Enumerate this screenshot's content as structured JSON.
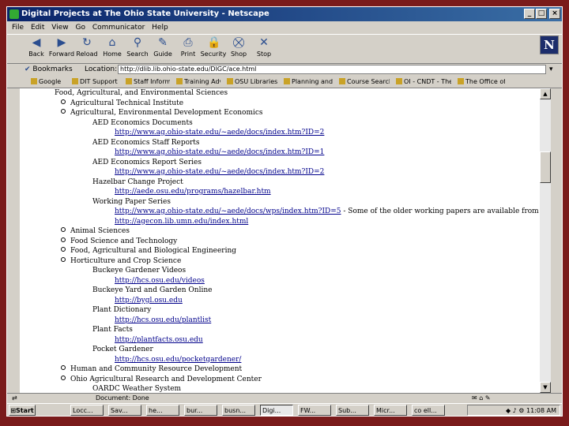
{
  "window": {
    "title": "Digital Projects at The Ohio State University - Netscape"
  },
  "menu": [
    "File",
    "Edit",
    "View",
    "Go",
    "Communicator",
    "Help"
  ],
  "toolbar": [
    {
      "label": "Back",
      "icon": "back-arrow-icon",
      "glyph": "◀"
    },
    {
      "label": "Forward",
      "icon": "forward-arrow-icon",
      "glyph": "▶"
    },
    {
      "label": "Reload",
      "icon": "reload-icon",
      "glyph": "↻"
    },
    {
      "label": "Home",
      "icon": "home-icon",
      "glyph": "⌂"
    },
    {
      "label": "Search",
      "icon": "search-icon",
      "glyph": "⚲"
    },
    {
      "label": "Guide",
      "icon": "guide-icon",
      "glyph": "✎"
    },
    {
      "label": "Print",
      "icon": "print-icon",
      "glyph": "⎙"
    },
    {
      "label": "Security",
      "icon": "lock-icon",
      "glyph": "🔒"
    },
    {
      "label": "Shop",
      "icon": "shop-icon",
      "glyph": "⛒"
    },
    {
      "label": "Stop",
      "icon": "stop-icon",
      "glyph": "✕"
    }
  ],
  "location": {
    "bookmarks_label": "Bookmarks",
    "location_label": "Location:",
    "url": "http://dlib.lib.ohio-state.edu/DIGC/ace.html"
  },
  "bookmarks": [
    "Google",
    "DIT Support Cen",
    "Staff Informati",
    "Training Advisc",
    "OSU Libraries C",
    "Planning and Pc",
    "Course Search F",
    "OI - CNDT - The OII",
    "The Office of I"
  ],
  "content": {
    "top_heading": "Food, Agricultural, and Environmental Sciences",
    "items": [
      {
        "type": "bullet",
        "text": "Agricultural Technical Institute"
      },
      {
        "type": "bullet",
        "text": "Agricultural, Environmental Development Economics"
      },
      {
        "type": "sub",
        "text": "AED Economics Documents"
      },
      {
        "type": "link",
        "text": "http://www.ag.ohio-state.edu/~aede/docs/index.htm?ID=2"
      },
      {
        "type": "sub",
        "text": "AED Economics Staff Reports"
      },
      {
        "type": "link",
        "text": "http://www.ag.ohio-state.edu/~aede/docs/index.htm?ID=1"
      },
      {
        "type": "sub",
        "text": "AED Economics Report Series"
      },
      {
        "type": "link",
        "text": "http://www.ag.ohio-state.edu/~aede/docs/index.htm?ID=2"
      },
      {
        "type": "sub",
        "text": "Hazelbar Change Project"
      },
      {
        "type": "link",
        "text": "http://aede.osu.edu/programs/hazelbar.htm"
      },
      {
        "type": "sub",
        "text": "Working Paper Series"
      },
      {
        "type": "linkmix",
        "text": "http://www.ag.ohio-state.edu/~aede/docs/wps/index.htm?ID=5",
        "note": " - Some of the older working papers are available from"
      },
      {
        "type": "link",
        "text": "http://agecon.lib.umn.edu/index.html"
      },
      {
        "type": "bullet",
        "text": "Animal Sciences"
      },
      {
        "type": "bullet",
        "text": "Food Science and Technology"
      },
      {
        "type": "bullet",
        "text": "Food, Agricultural and Biological Engineering"
      },
      {
        "type": "bullet",
        "text": "Horticulture and Crop Science"
      },
      {
        "type": "sub",
        "text": "Buckeye Gardener Videos"
      },
      {
        "type": "link",
        "text": "http://hcs.osu.edu/videos"
      },
      {
        "type": "sub",
        "text": "Buckeye Yard and Garden Online"
      },
      {
        "type": "link",
        "text": "http://bygl.osu.edu"
      },
      {
        "type": "sub",
        "text": "Plant Dictionary"
      },
      {
        "type": "link",
        "text": "http://hcs.osu.edu/plantlist"
      },
      {
        "type": "sub",
        "text": "Plant Facts"
      },
      {
        "type": "link",
        "text": "http://plantfacts.osu.edu"
      },
      {
        "type": "sub",
        "text": "Pocket Gardener"
      },
      {
        "type": "link",
        "text": "http://hcs.osu.edu/pocketgardener/"
      },
      {
        "type": "bullet",
        "text": "Human and Community Resource Development"
      },
      {
        "type": "bullet",
        "text": "Ohio Agricultural Research and Development Center"
      },
      {
        "type": "sub",
        "text": "OARDC Weather System"
      }
    ]
  },
  "status": {
    "text": "Document: Done"
  },
  "taskbar": {
    "start_label": "Start",
    "tasks": [
      "Locc...",
      "Sav...",
      "he...",
      "bur...",
      "busn...",
      "Digi...",
      "FW...",
      "Sub...",
      "Micr...",
      "co ell..."
    ],
    "active_index": 5,
    "clock": "11:08 AM"
  },
  "colors": {
    "outer_background": "#7a1b1b",
    "titlebar": "#0a246a",
    "link": "#00008b",
    "chrome": "#d4d0c8"
  }
}
